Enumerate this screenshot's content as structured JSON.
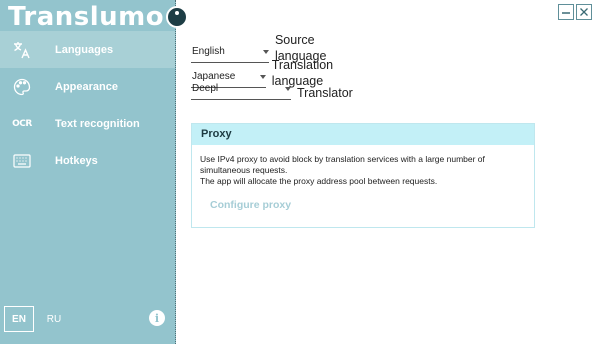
{
  "app": {
    "title": "Translumo"
  },
  "sidebar": {
    "items": [
      {
        "label": "Languages",
        "icon": "translate-icon",
        "active": true
      },
      {
        "label": "Appearance",
        "icon": "palette-icon",
        "active": false
      },
      {
        "label": "Text recognition",
        "icon": "ocr-icon",
        "active": false
      },
      {
        "label": "Hotkeys",
        "icon": "keyboard-icon",
        "active": false
      }
    ],
    "ocr_glyph": "OCR",
    "lang_switch": {
      "en": "EN",
      "ru": "RU",
      "selected": "EN"
    },
    "info_glyph": "i"
  },
  "window_controls": {
    "minimize": "—",
    "close": "✕"
  },
  "settings": {
    "source": {
      "value": "English",
      "label": "Source language"
    },
    "translation": {
      "value": "Japanese",
      "label": "Translation language"
    },
    "translator": {
      "value": "Deepl",
      "label": "Translator"
    }
  },
  "proxy": {
    "title": "Proxy",
    "description_line1": "Use IPv4 proxy to avoid block by translation services with a large number of simultaneous requests.",
    "description_line2": "The app will allocate the proxy address pool between requests.",
    "configure_label": "Configure proxy"
  },
  "colors": {
    "sidebar_bg": "#93c4cd",
    "sidebar_active": "#a8d0d6",
    "proxy_header": "#c3f0f7",
    "configure_text": "#a6cdd6"
  }
}
